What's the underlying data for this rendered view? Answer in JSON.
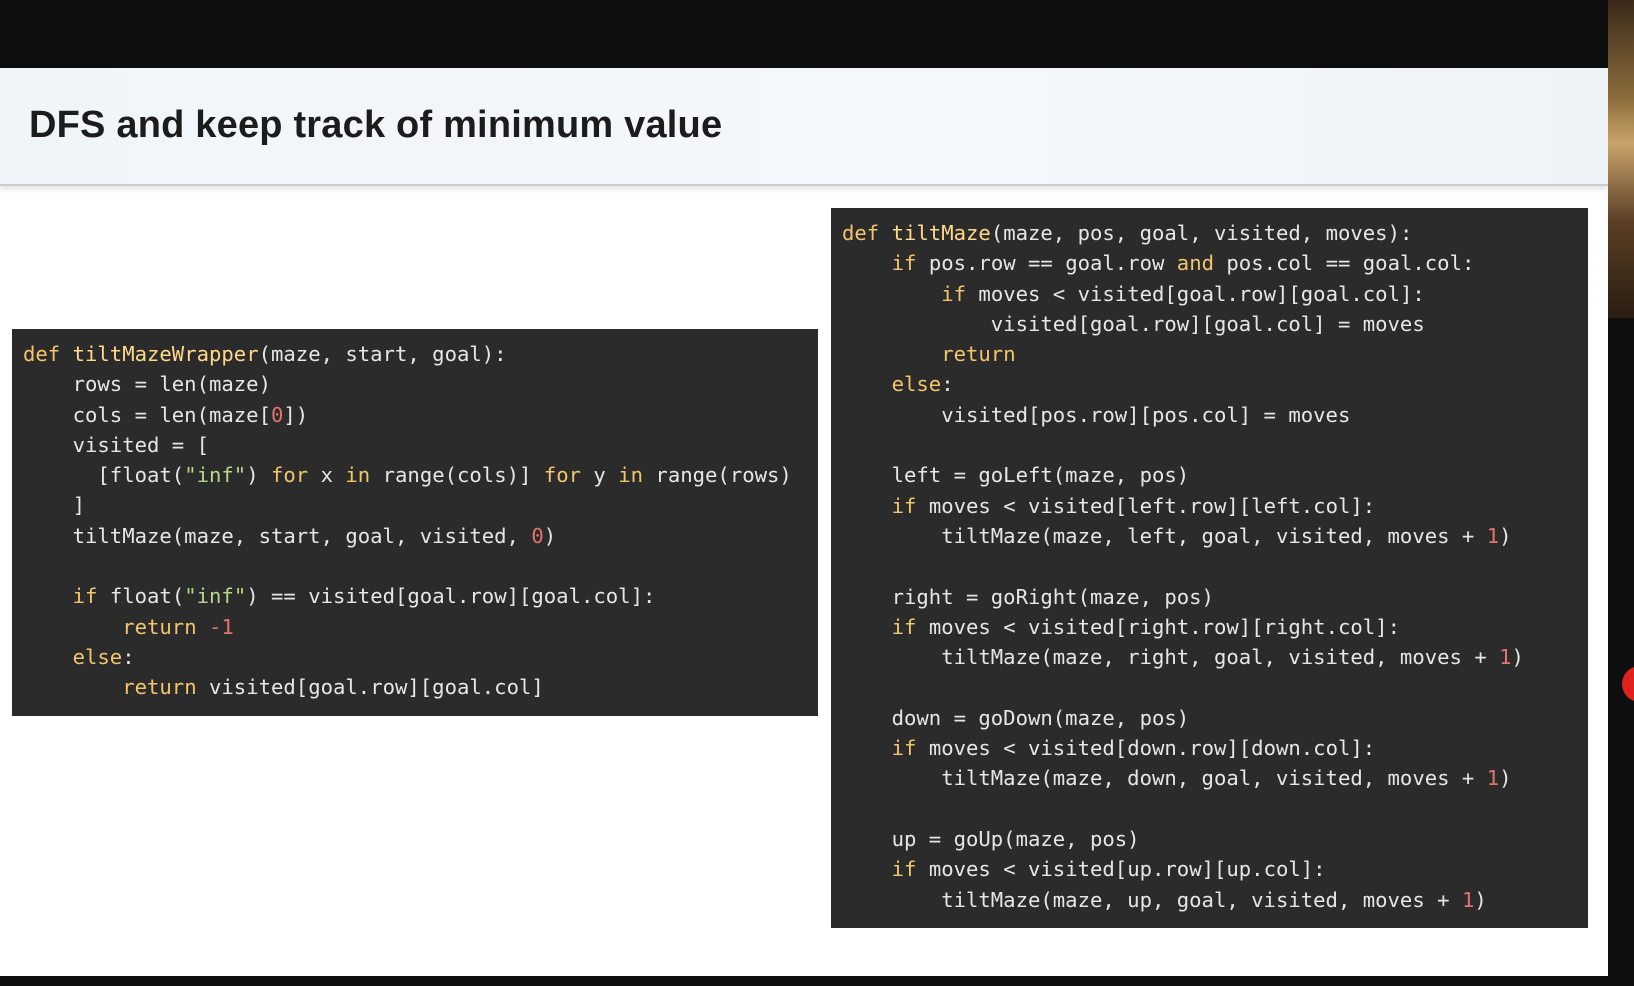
{
  "slide": {
    "title": "DFS and keep track of minimum value"
  },
  "code_blocks": {
    "wrapper": {
      "language": "python",
      "lines": [
        [
          [
            "kw",
            "def"
          ],
          [
            "t",
            " "
          ],
          [
            "fn",
            "tiltMazeWrapper"
          ],
          [
            "t",
            "(maze, start, goal):"
          ]
        ],
        [
          [
            "t",
            "    rows = len(maze)"
          ]
        ],
        [
          [
            "t",
            "    cols = len(maze["
          ],
          [
            "num",
            "0"
          ],
          [
            "t",
            "])"
          ]
        ],
        [
          [
            "t",
            "    visited = ["
          ]
        ],
        [
          [
            "t",
            "      [float("
          ],
          [
            "str",
            "\"inf\""
          ],
          [
            "t",
            ") "
          ],
          [
            "kw",
            "for"
          ],
          [
            "t",
            " x "
          ],
          [
            "kw",
            "in"
          ],
          [
            "t",
            " range(cols)] "
          ],
          [
            "kw",
            "for"
          ],
          [
            "t",
            " y "
          ],
          [
            "kw",
            "in"
          ],
          [
            "t",
            " range(rows)"
          ]
        ],
        [
          [
            "t",
            "    ]"
          ]
        ],
        [
          [
            "t",
            "    tiltMaze(maze, start, goal, visited, "
          ],
          [
            "num",
            "0"
          ],
          [
            "t",
            ")"
          ]
        ],
        [
          [
            "t",
            ""
          ]
        ],
        [
          [
            "t",
            "    "
          ],
          [
            "kw",
            "if"
          ],
          [
            "t",
            " float("
          ],
          [
            "str",
            "\"inf\""
          ],
          [
            "t",
            ") == visited[goal.row][goal.col]:"
          ]
        ],
        [
          [
            "t",
            "        "
          ],
          [
            "kw",
            "return"
          ],
          [
            "t",
            " "
          ],
          [
            "num",
            "-1"
          ]
        ],
        [
          [
            "t",
            "    "
          ],
          [
            "kw",
            "else"
          ],
          [
            "t",
            ":"
          ]
        ],
        [
          [
            "t",
            "        "
          ],
          [
            "kw",
            "return"
          ],
          [
            "t",
            " visited[goal.row][goal.col]"
          ]
        ]
      ]
    },
    "tilt_maze": {
      "language": "python",
      "lines": [
        [
          [
            "kw",
            "def"
          ],
          [
            "t",
            " "
          ],
          [
            "fn",
            "tiltMaze"
          ],
          [
            "t",
            "(maze, pos, goal, visited, moves):"
          ]
        ],
        [
          [
            "t",
            "    "
          ],
          [
            "kw",
            "if"
          ],
          [
            "t",
            " pos.row == goal.row "
          ],
          [
            "kw",
            "and"
          ],
          [
            "t",
            " pos.col == goal.col:"
          ]
        ],
        [
          [
            "t",
            "        "
          ],
          [
            "kw",
            "if"
          ],
          [
            "t",
            " moves < visited[goal.row][goal.col]:"
          ]
        ],
        [
          [
            "t",
            "            visited[goal.row][goal.col] = moves"
          ]
        ],
        [
          [
            "t",
            "        "
          ],
          [
            "kw",
            "return"
          ]
        ],
        [
          [
            "t",
            "    "
          ],
          [
            "kw",
            "else"
          ],
          [
            "t",
            ":"
          ]
        ],
        [
          [
            "t",
            "        visited[pos.row][pos.col] = moves"
          ]
        ],
        [
          [
            "t",
            ""
          ]
        ],
        [
          [
            "t",
            "    left = goLeft(maze, pos)"
          ]
        ],
        [
          [
            "t",
            "    "
          ],
          [
            "kw",
            "if"
          ],
          [
            "t",
            " moves < visited[left.row][left.col]:"
          ]
        ],
        [
          [
            "t",
            "        tiltMaze(maze, left, goal, visited, moves + "
          ],
          [
            "num",
            "1"
          ],
          [
            "t",
            ")"
          ]
        ],
        [
          [
            "t",
            ""
          ]
        ],
        [
          [
            "t",
            "    right = goRight(maze, pos)"
          ]
        ],
        [
          [
            "t",
            "    "
          ],
          [
            "kw",
            "if"
          ],
          [
            "t",
            " moves < visited[right.row][right.col]:"
          ]
        ],
        [
          [
            "t",
            "        tiltMaze(maze, right, goal, visited, moves + "
          ],
          [
            "num",
            "1"
          ],
          [
            "t",
            ")"
          ]
        ],
        [
          [
            "t",
            ""
          ]
        ],
        [
          [
            "t",
            "    down = goDown(maze, pos)"
          ]
        ],
        [
          [
            "t",
            "    "
          ],
          [
            "kw",
            "if"
          ],
          [
            "t",
            " moves < visited[down.row][down.col]:"
          ]
        ],
        [
          [
            "t",
            "        tiltMaze(maze, down, goal, visited, moves + "
          ],
          [
            "num",
            "1"
          ],
          [
            "t",
            ")"
          ]
        ],
        [
          [
            "t",
            ""
          ]
        ],
        [
          [
            "t",
            "    up = goUp(maze, pos)"
          ]
        ],
        [
          [
            "t",
            "    "
          ],
          [
            "kw",
            "if"
          ],
          [
            "t",
            " moves < visited[up.row][up.col]:"
          ]
        ],
        [
          [
            "t",
            "        tiltMaze(maze, up, goal, visited, moves + "
          ],
          [
            "num",
            "1"
          ],
          [
            "t",
            ")"
          ]
        ]
      ]
    }
  },
  "colors": {
    "code_background": "#2b2b2b",
    "code_text": "#e6e6e6",
    "keyword": "#f2c56b",
    "function_name": "#ffd98a",
    "string": "#b5d88a",
    "number": "#e0746c",
    "record_indicator": "#e0221f"
  }
}
